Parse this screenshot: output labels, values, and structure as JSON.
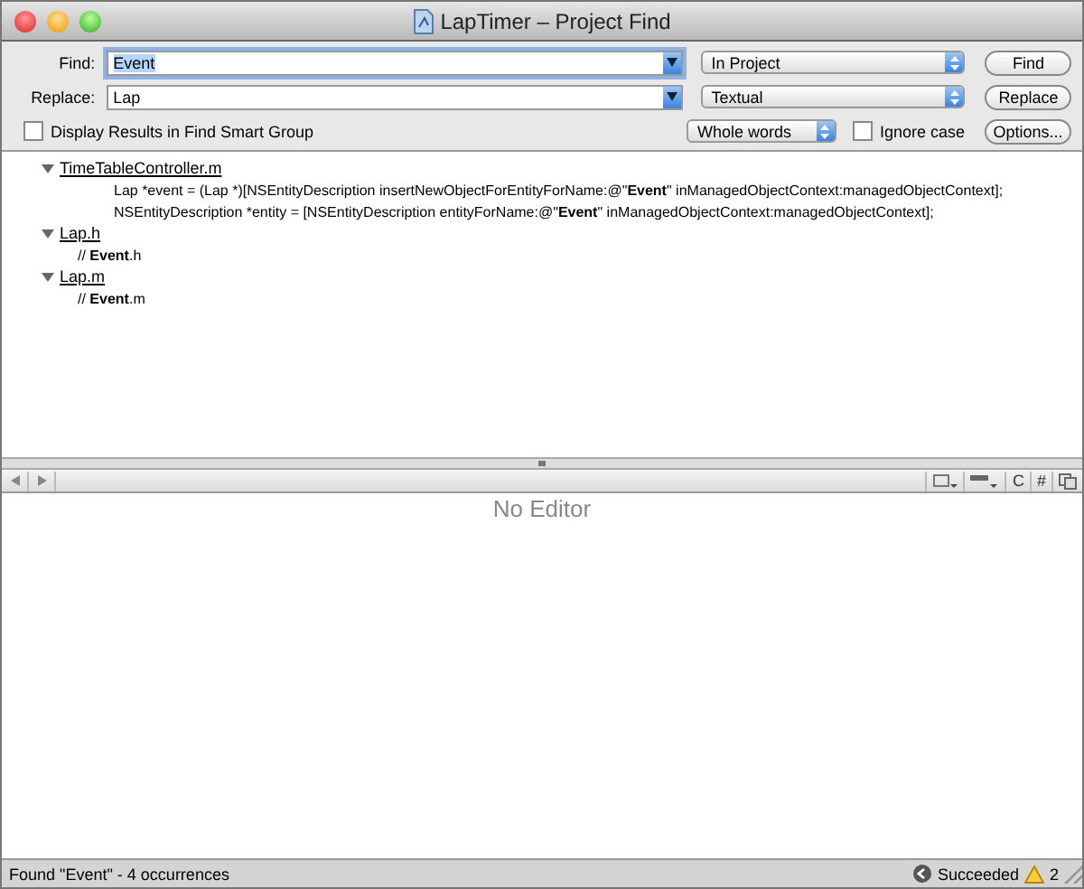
{
  "window": {
    "title": "LapTimer – Project Find"
  },
  "find": {
    "label": "Find:",
    "value": "Event",
    "scope": "In Project",
    "button": "Find"
  },
  "replace": {
    "label": "Replace:",
    "value": "Lap",
    "mode": "Textual",
    "button": "Replace"
  },
  "options": {
    "smart_group": {
      "label": "Display Results in Find Smart Group",
      "checked": false
    },
    "match": "Whole words",
    "ignore_case": {
      "label": "Ignore case",
      "checked": false
    },
    "button": "Options..."
  },
  "results": [
    {
      "file": "TimeTableController.m",
      "expanded": true,
      "children": [
        "Lap *event = (Lap *)[NSEntityDescription insertNewObjectForEntityForName:@\"**Event**\" inManagedObjectContext:managedObjectContext];",
        "NSEntityDescription *entity = [NSEntityDescription entityForName:@\"**Event**\" inManagedObjectContext:managedObjectContext];"
      ]
    },
    {
      "file": "Lap.h",
      "expanded": true,
      "children": [
        "//  **Event**.h"
      ]
    },
    {
      "file": "Lap.m",
      "expanded": true,
      "children": [
        "//  **Event**.m"
      ]
    }
  ],
  "editor_toolbar": {
    "menus": [
      "C",
      "#"
    ]
  },
  "editor": {
    "placeholder": "No Editor"
  },
  "status_bar": {
    "message": "Found \"Event\" - 4 occurrences",
    "build": "Succeeded",
    "warnings": "2"
  }
}
